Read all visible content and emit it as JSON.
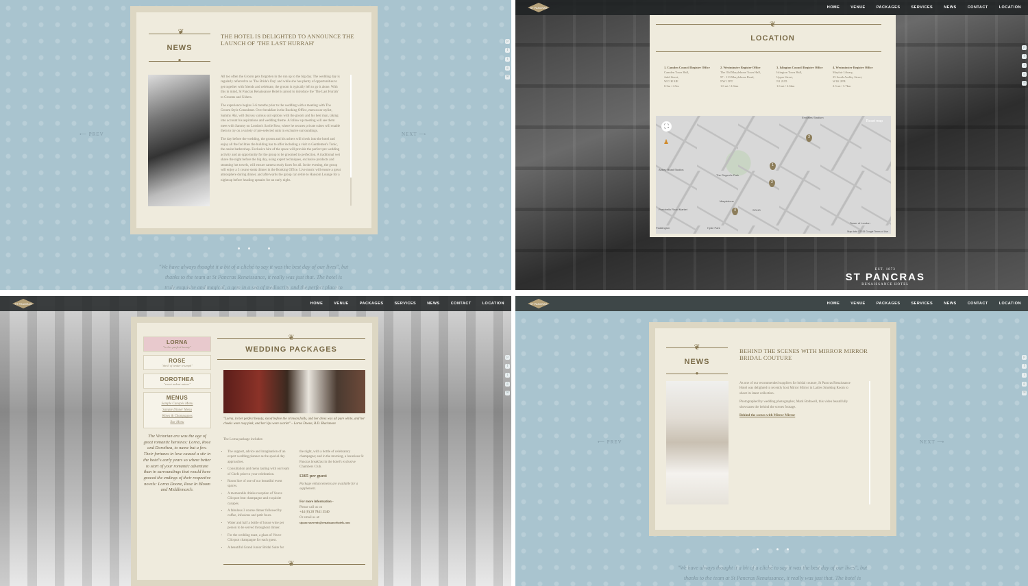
{
  "colors": {
    "blue_bg": "#a9c4cf",
    "paper": "#efebdd",
    "frame": "#ddd7c3",
    "accent": "#7a6b48",
    "pink": "#e8c9cd"
  },
  "icons": [
    "pinterest-icon",
    "facebook-icon",
    "twitter-icon",
    "google-plus-icon",
    "email-icon",
    "ornament-icon",
    "arrow-left-icon",
    "arrow-right-icon",
    "map-pin-icon",
    "fullscreen-icon",
    "pegman-icon"
  ],
  "nav": {
    "home": "HOME",
    "venue": "VENUE",
    "packages": "PACKAGES",
    "services": "SERVICES",
    "news": "NEWS",
    "contact": "CONTACT",
    "location": "LOCATION"
  },
  "logo": {
    "text": "ST PANCRAS"
  },
  "news1": {
    "title": "NEWS",
    "headline": "THE HOTEL IS DELIGHTED TO ANNOUNCE THE LAUNCH OF 'THE LAST HURRAH'",
    "p1": "All too often the Groom gets forgotten in the run up to the big day. The wedding day is regularly referred to as 'The Bride's Day' and while she has plenty of opportunities to get together with friends and celebrate, the groom is typically left to go it alone. With this in mind, St Pancras Renaissance Hotel is proud to introduce the 'The Last Hurrah' to Grooms and Ushers.",
    "p2": "The experience begins 3-6 months prior to the wedding with a meeting with The Groom Style Consultant. Over breakfast in the Booking Office, menswear stylist, Sammy Aki, will discuss various suit options with the groom and his best man, taking into account his aspirations and wedding theme. A follow up meeting will see them meet with Sammy on London's Savile Row, where he secures private suites will enable them to try on a variety of pre-selected suits in exclusive surroundings.",
    "p3": "The day before the wedding, the groom and his ushers will check into the hotel and enjoy all the facilities the building has to offer including a visit to Gentlemen's Tonic, the onsite barbershop. Exclusive hire of the space will provide the perfect pre wedding activity and an opportunity for the group to be groomed to perfection. A traditional wet shave the night before the big day, using expert techniques, exclusive products and steaming hot towels, will ensure camera ready faces for all. In the evening, the group will enjoy a 3 course steak dinner in the Booking Office. Live music will ensure a great atmosphere during dinner, and afterwards the group can retire to Hansom Lounge for a nightcap before heading upstairs for an early night.",
    "prev": "PREV",
    "next": "NEXT",
    "quote1": "\"We have always thought it a bit of a cliché to say it was the best day of our lives\", but",
    "quote2": "thanks to the team at St Pancras Renaissance, it really was just that. The hotel is",
    "quote3": "truly exquisite and magical, a gem in a sea of mediocrity and the perfect place to"
  },
  "location": {
    "title": "LOCATION",
    "c1": {
      "name": "1. Camden Council Register Office",
      "lines": [
        "Camden Town Hall,",
        "Judd Street,",
        "WC1H 9JE",
        "0.3m / 4.5m"
      ]
    },
    "c2": {
      "name": "2. Westminster Register Office",
      "lines": [
        "The Old Marylebone Town Hall,",
        "97 - 113 Marylebone Road,",
        "NW1 5PT",
        "1.6 mi / 2.6km"
      ]
    },
    "c3": {
      "name": "3. Islington Council Register Office",
      "lines": [
        "Islington Town Hall,",
        "Upper Street,",
        "N1 2UD",
        "1.6 mi / 2.6km"
      ]
    },
    "c4": {
      "name": "4. Westminster Register Office",
      "lines": [
        "Mayfair Library,",
        "25 South Audley Street,",
        "W1K 2PB",
        "2.3 mi / 3.7km"
      ]
    },
    "map": {
      "reset": "Reset map",
      "emirates": "Emirates Stadium",
      "park": "The Regent's Park",
      "abbey": "Abbey Road Studios",
      "portobello": "Portobello Road Market",
      "hyde": "Hyde Park",
      "soho": "SOHO",
      "tower": "Tower of London",
      "marylebone": "Marylebone",
      "paddington": "Paddington",
      "terms": "Map data ©2015 Google  Terms of Use"
    },
    "pins": [
      "1",
      "2",
      "3",
      "4"
    ],
    "stp1": "EST. 1873",
    "stp2": "ST PANCRAS",
    "stp3": "RENAISSANCE HOTEL"
  },
  "packages": {
    "items": [
      {
        "t": "LORNA",
        "s": "\"to her perfect beauty\""
      },
      {
        "t": "ROSE",
        "s": "\"thrill of tender triumph\""
      },
      {
        "t": "DOROTHEA",
        "s": "\"sweet ardent nature\""
      }
    ],
    "menus": {
      "t": "MENUS",
      "links": [
        "Sample Canapés Menu",
        "Sample Dinner Menu",
        "Wines & Champagnes",
        "Bar Menu"
      ]
    },
    "sidetext": "The Victorian era was the age of great romantic heroines: Lorna, Rose and Dorothea, to name but a few. Their fortunes in love caused a stir in the hotel's early years so where better to start of your romantic adventure than in surroundings that would have graced the endings of their respective novels: Lorna Doone, Rose In Bloom and Middlemarch.",
    "title": "WEDDING PACKAGES",
    "caption": "\"Lorna, in her perfect beauty, stood before the crimson folds, and her dress was all pure white, and her cheeks were rosy pink, and her lips were scarlet\" – Lorna Doone, R.D. Blackmore",
    "includes": "The Lorna package includes:",
    "left": [
      "The support, advice and imagination of an expert wedding planner as the special day approaches.",
      "Consultation and menu tasting with our team of Chefs prior to your celebration.",
      "Room hire of one of our beautiful event spaces.",
      "A memorable drinks reception of Veuve Clicquot brut champagne and exquisite canapés.",
      "A fabulous 3 course dinner followed by coffee, infusions and petit fours.",
      "Water and half a bottle of house wine per person to be served throughout dinner.",
      "For the wedding toast, a glass of Veuve Clicquot champagne for each guest.",
      "A beautiful Grand Junior Bridal Suite for"
    ],
    "right1": "the night, with a bottle of celebratory champagne; and in the morning, a luxurious St Pancras breakfast in the hotel's exclusive Chambers Club.",
    "price": "£165 per guest",
    "right2": "Package enhancements are available for a supplement.",
    "info": "For more information -",
    "call": "Please call us on",
    "phone": "+44 (0) 20 7841 3540",
    "email_label": "Or email us at:",
    "email": "stpancrasevents@renaissancehotels.com"
  },
  "news2": {
    "title": "NEWS",
    "headline": "BEHIND THE SCENES WITH MIRROR MIRROR BRIDAL COUTURE",
    "p1": "As one of our recommended suppliers for bridal couture, St Pancras Renaissance Hotel was delighted to recently host Mirror Mirror in Ladies Smoking Room to shoot its latest collection.",
    "p2": "Photographed by wedding photographer, Mark Bothwell, this video beautifully showcases the behind the scenes footage.",
    "link": "Behind the scenes with Mirror Mirror",
    "prev": "PREV",
    "next": "NEXT",
    "quote1": "\"We have always thought it a bit of a cliché to say it was the best day of our lives\", but",
    "quote2": "thanks to the team at St Pancras Renaissance, it really was just that. The hotel is"
  }
}
